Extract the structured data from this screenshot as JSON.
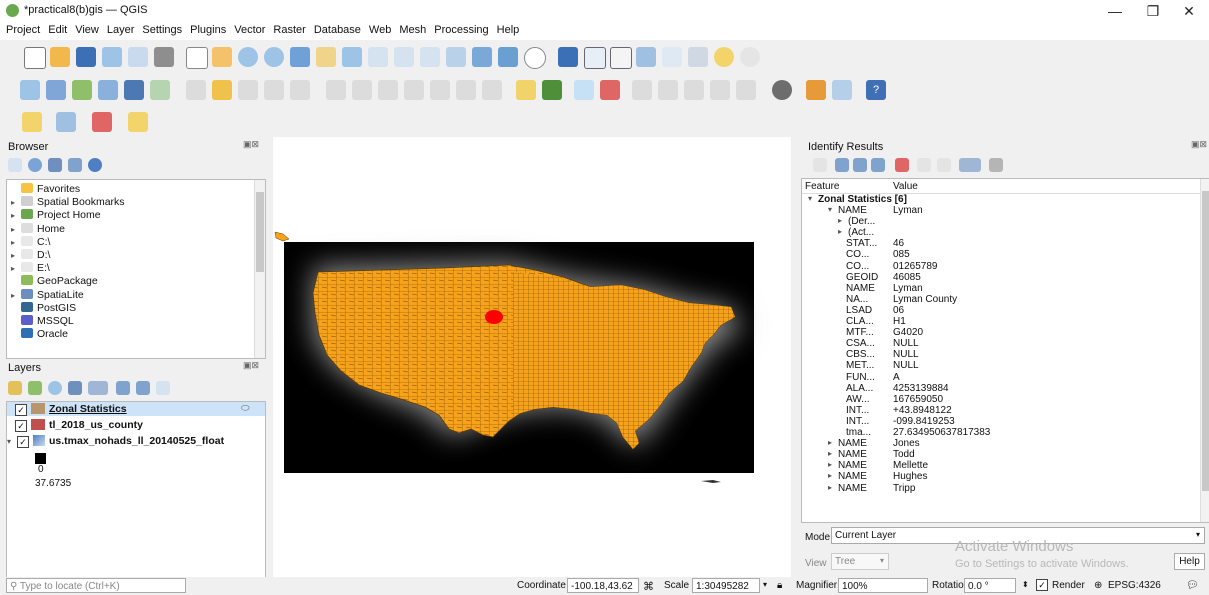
{
  "window": {
    "title": "*practical8(b)gis — QGIS",
    "minimize": "—",
    "restore": "❐",
    "close": "✕"
  },
  "menu": [
    "Project",
    "Edit",
    "View",
    "Layer",
    "Settings",
    "Plugins",
    "Vector",
    "Raster",
    "Database",
    "Web",
    "Mesh",
    "Processing",
    "Help"
  ],
  "browser": {
    "title": "Browser",
    "items": [
      {
        "label": "Favorites",
        "expand": "",
        "icon_color": "#f6c343"
      },
      {
        "label": "Spatial Bookmarks",
        "expand": "▸",
        "icon_color": "#cfcfcf"
      },
      {
        "label": "Project Home",
        "expand": "▸",
        "icon_color": "#6aa84f"
      },
      {
        "label": "Home",
        "expand": "▸",
        "icon_color": "#dddddd"
      },
      {
        "label": "C:\\",
        "expand": "▸",
        "icon_color": "#e8e8e8"
      },
      {
        "label": "D:\\",
        "expand": "▸",
        "icon_color": "#e8e8e8"
      },
      {
        "label": "E:\\",
        "expand": "▸",
        "icon_color": "#e8e8e8"
      },
      {
        "label": "GeoPackage",
        "expand": "",
        "icon_color": "#8fbc5a"
      },
      {
        "label": "SpatiaLite",
        "expand": "▸",
        "icon_color": "#6c8ebf"
      },
      {
        "label": "PostGIS",
        "expand": "",
        "icon_color": "#336791"
      },
      {
        "label": "MSSQL",
        "expand": "",
        "icon_color": "#5b5fc7"
      },
      {
        "label": "Oracle",
        "expand": "",
        "icon_color": "#2f6fb5"
      }
    ]
  },
  "layers": {
    "title": "Layers",
    "items": [
      {
        "label": "Zonal Statistics",
        "checked": "✓",
        "swatch": "#b8956b",
        "bold": true
      },
      {
        "label": "tl_2018_us_county",
        "checked": "✓",
        "swatch": "#c0504d",
        "bold": true
      },
      {
        "label": "us.tmax_nohads_ll_20140525_float",
        "checked": "✓",
        "swatch": "",
        "bold": true
      }
    ],
    "legend_min": "0",
    "legend_max": "37.6735"
  },
  "identify": {
    "title": "Identify Results",
    "col_feature": "Feature",
    "col_value": "Value",
    "root": "Zonal Statistics  [6]",
    "rows": [
      {
        "k": "NAME",
        "v": "Lyman"
      },
      {
        "k": "(Der...",
        "v": ""
      },
      {
        "k": "(Act...",
        "v": ""
      },
      {
        "k": "STAT...",
        "v": "46"
      },
      {
        "k": "CO...",
        "v": "085"
      },
      {
        "k": "CO...",
        "v": "01265789"
      },
      {
        "k": "GEOID",
        "v": "46085"
      },
      {
        "k": "NAME",
        "v": "Lyman"
      },
      {
        "k": "NA...",
        "v": "Lyman County"
      },
      {
        "k": "LSAD",
        "v": "06"
      },
      {
        "k": "CLA...",
        "v": "H1"
      },
      {
        "k": "MTF...",
        "v": "G4020"
      },
      {
        "k": "CSA...",
        "v": "NULL"
      },
      {
        "k": "CBS...",
        "v": "NULL"
      },
      {
        "k": "MET...",
        "v": "NULL"
      },
      {
        "k": "FUN...",
        "v": "A"
      },
      {
        "k": "ALA...",
        "v": "4253139884"
      },
      {
        "k": "AW...",
        "v": "167659050"
      },
      {
        "k": "INT...",
        "v": "+43.8948122"
      },
      {
        "k": "INT...",
        "v": "-099.8419253"
      },
      {
        "k": "tma...",
        "v": "27.634950637817383"
      },
      {
        "k": "NAME",
        "v": "Jones"
      },
      {
        "k": "NAME",
        "v": "Todd"
      },
      {
        "k": "NAME",
        "v": "Mellette"
      },
      {
        "k": "NAME",
        "v": "Hughes"
      },
      {
        "k": "NAME",
        "v": "Tripp"
      }
    ],
    "mode_label": "Mode",
    "mode_value": "Current Layer",
    "view_label": "View",
    "view_value": "Tree",
    "help": "Help"
  },
  "watermark": {
    "line1": "Activate Windows",
    "line2": "Go to Settings to activate Windows."
  },
  "status": {
    "locate_placeholder": "Type to locate (Ctrl+K)",
    "coordinate_label": "Coordinate",
    "coordinate": "-100.18,43.62",
    "scale_label": "Scale",
    "scale": "1:30495282",
    "magnifier_label": "Magnifier",
    "magnifier": "100%",
    "rotation_label": "Rotation",
    "rotation": "0.0 °",
    "render_label": "Render",
    "crs": "EPSG:4326"
  },
  "colors": {
    "map_fill": "#f7a21b",
    "selected": "#ff0000",
    "raster_bg": "#000000"
  }
}
